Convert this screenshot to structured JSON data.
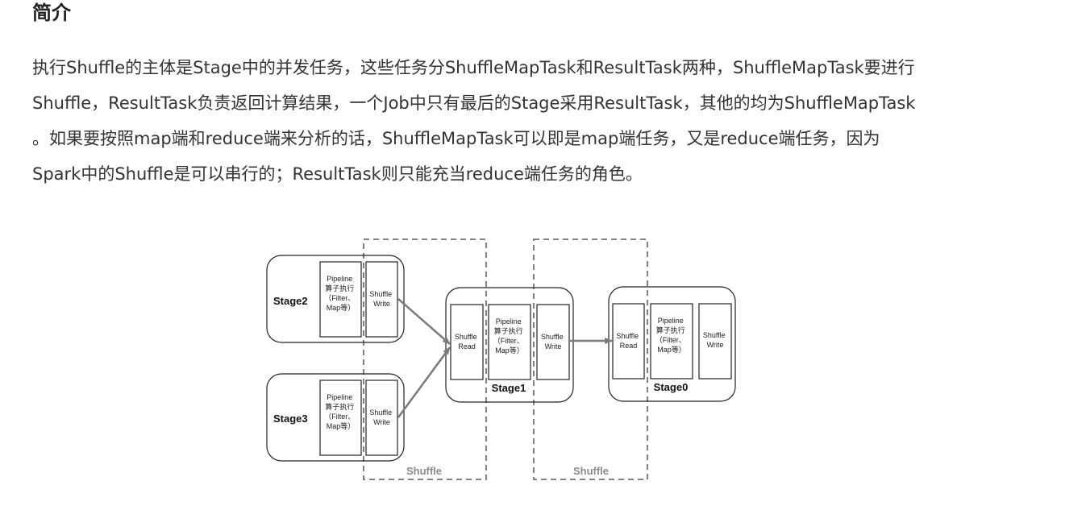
{
  "heading": "简介",
  "paragraph": {
    "lines": [
      "执行Shuffle的主体是Stage中的并发任务，这些任务分ShuffleMapTask和ResultTask两种，ShuffleMapTask要进行",
      "Shuffle，ResultTask负责返回计算结果，一个Job中只有最后的Stage采用ResultTask，其他的均为ShuffleMapTask",
      "。如果要按照map端和reduce端来分析的话，ShuffleMapTask可以即是map端任务，又是reduce端任务，因为",
      "Spark中的Shuffle是可以串行的；ResultTask则只能充当reduce端任务的角色。"
    ]
  },
  "diagram": {
    "stage2": {
      "label": "Stage2",
      "pipeline": [
        "Pipeline",
        "算子执行",
        "（Filter、",
        "Map等）"
      ],
      "write": [
        "Shuffle",
        "Write"
      ]
    },
    "stage3": {
      "label": "Stage3",
      "pipeline": [
        "Pipeline",
        "算子执行",
        "（Filter、",
        "Map等）"
      ],
      "write": [
        "Shuffle",
        "Write"
      ]
    },
    "stage1": {
      "label": "Stage1",
      "read": [
        "Shuffle",
        "Read"
      ],
      "pipeline": [
        "Pipeline",
        "算子执行",
        "（Filter、",
        "Map等）"
      ],
      "write": [
        "Shuffle",
        "Write"
      ]
    },
    "stage0": {
      "label": "Stage0",
      "read": [
        "Shuffle",
        "Read"
      ],
      "pipeline": [
        "Pipeline",
        "算子执行",
        "（Filter、",
        "Map等）"
      ],
      "write": [
        "Shuffle",
        "Write"
      ]
    },
    "shuffle_labels": [
      "Shuffle",
      "Shuffle"
    ],
    "colors": {
      "stroke": "#222222",
      "dashed": "#808080",
      "arrow": "#7a7a7a",
      "shuffle_label": "#8a8a8a"
    }
  }
}
